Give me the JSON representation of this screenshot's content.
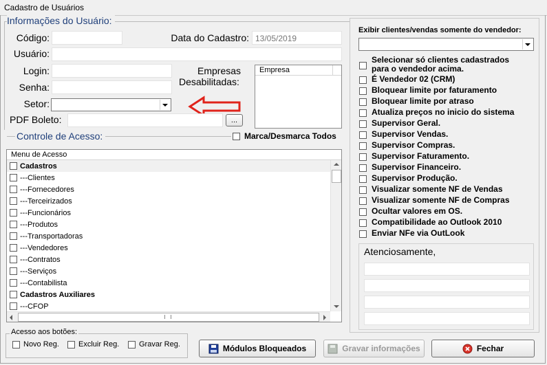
{
  "window": {
    "title": "Cadastro de Usuários"
  },
  "user_info": {
    "group_title": "Informações do Usuário:",
    "codigo_label": "Código:",
    "codigo_value": "",
    "data_cadastro_label": "Data do Cadastro:",
    "data_cadastro_value": "13/05/2019",
    "usuario_label": "Usuário:",
    "usuario_value": "",
    "login_label": "Login:",
    "login_value": "",
    "senha_label": "Senha:",
    "senha_value": "",
    "setor_label": "Setor:",
    "setor_value": "",
    "pdf_boleto_label": "PDF Boleto:",
    "pdf_boleto_value": "",
    "pdf_browse_label": "...",
    "empresas_label_1": "Empresas",
    "empresas_label_2": "Desabilitadas:",
    "empresas_col_header": "Empresa",
    "annotation": "red-arrow-pointing-left",
    "annotation_color": "#e0231b"
  },
  "access_control": {
    "group_title": "Controle de Acesso:",
    "toggle_all_label": "Marca/Desmarca Todos",
    "list_header": "Menu de Acesso",
    "items": [
      {
        "label": "Cadastros",
        "bold": true
      },
      {
        "label": "---Clientes",
        "bold": false
      },
      {
        "label": "---Fornecedores",
        "bold": false
      },
      {
        "label": "---Terceirizados",
        "bold": false
      },
      {
        "label": "---Funcionários",
        "bold": false
      },
      {
        "label": "---Produtos",
        "bold": false
      },
      {
        "label": "---Transportadoras",
        "bold": false
      },
      {
        "label": "---Vendedores",
        "bold": false
      },
      {
        "label": "---Contratos",
        "bold": false
      },
      {
        "label": "---Serviços",
        "bold": false
      },
      {
        "label": "---Contabilista",
        "bold": false
      },
      {
        "label": "Cadastros Auxiliares",
        "bold": true
      },
      {
        "label": "---CFOP",
        "bold": false
      }
    ]
  },
  "buttons_access": {
    "group_title": "Acesso aos botões:",
    "novo": "Novo Reg.",
    "excluir": "Excluir Reg.",
    "gravar": "Gravar Reg."
  },
  "right_panel": {
    "vendor_filter_label": "Exibir clientes/vendas somente do vendedor:",
    "vendor_filter_value": "",
    "options": [
      [
        "Selecionar só clientes cadastrados",
        "para o vendedor acima."
      ],
      [
        "É Vendedor 02 (CRM)"
      ],
      [
        "Bloquear limite por faturamento"
      ],
      [
        "Bloquear limite por atraso"
      ],
      [
        "Atualiza preços no inicio do sistema"
      ],
      [
        "Supervisor Geral."
      ],
      [
        "Supervisor Vendas."
      ],
      [
        "Supervisor Compras."
      ],
      [
        "Supervisor Faturamento."
      ],
      [
        "Supervisor Financeiro."
      ],
      [
        "Supervisor Produção."
      ],
      [
        "Visualizar somente NF de Vendas"
      ],
      [
        "Visualizar somente NF de Compras"
      ],
      [
        "Ocultar valores em OS."
      ],
      [
        "Compatibilidade ao Outlook 2010"
      ],
      [
        "Enviar NFe via OutLook"
      ]
    ],
    "signature_label": "Atenciosamente,"
  },
  "footer": {
    "modulos_label": "Módulos Bloqueados",
    "gravar_label": "Gravar informações",
    "fechar_label": "Fechar"
  },
  "colors": {
    "group_title": "#1f3f7a",
    "fechar_icon": "#d9342b",
    "save_icon": "#1f3f9a"
  }
}
